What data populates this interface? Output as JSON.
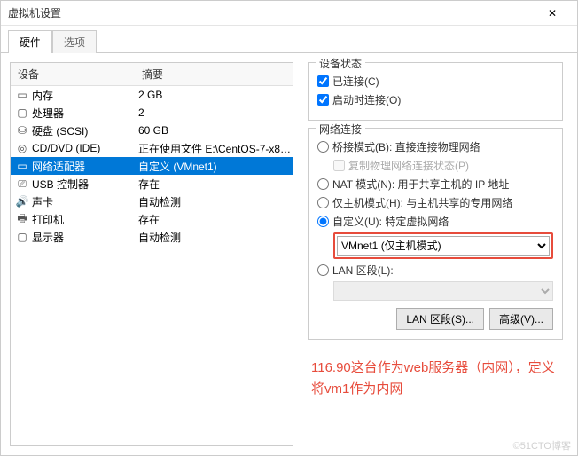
{
  "title": "虚拟机设置",
  "close": "✕",
  "tabs": {
    "hardware": "硬件",
    "options": "选项"
  },
  "listHeader": {
    "device": "设备",
    "summary": "摘要"
  },
  "devices": [
    {
      "icon": "▭",
      "name": "内存",
      "summary": "2 GB"
    },
    {
      "icon": "▢",
      "name": "处理器",
      "summary": "2"
    },
    {
      "icon": "⛁",
      "name": "硬盘 (SCSI)",
      "summary": "60 GB"
    },
    {
      "icon": "◎",
      "name": "CD/DVD (IDE)",
      "summary": "正在使用文件 E:\\CentOS-7-x86..."
    },
    {
      "icon": "▭",
      "name": "网络适配器",
      "summary": "自定义 (VMnet1)"
    },
    {
      "icon": "⎚",
      "name": "USB 控制器",
      "summary": "存在"
    },
    {
      "icon": "🔊",
      "name": "声卡",
      "summary": "自动检测"
    },
    {
      "icon": "🖶",
      "name": "打印机",
      "summary": "存在"
    },
    {
      "icon": "▢",
      "name": "显示器",
      "summary": "自动检测"
    }
  ],
  "deviceState": {
    "title": "设备状态",
    "connected": "已连接(C)",
    "connectAtStartup": "启动时连接(O)"
  },
  "netConn": {
    "title": "网络连接",
    "bridged": "桥接模式(B): 直接连接物理网络",
    "replicate": "复制物理网络连接状态(P)",
    "nat": "NAT 模式(N): 用于共享主机的 IP 地址",
    "hostOnly": "仅主机模式(H): 与主机共享的专用网络",
    "custom": "自定义(U): 特定虚拟网络",
    "customSelect": "VMnet1 (仅主机模式)",
    "lan": "LAN 区段(L):"
  },
  "buttons": {
    "lanSegments": "LAN 区段(S)...",
    "advanced": "高级(V)..."
  },
  "annotation": "116.90这台作为web服务器（内网），定义将vm1作为内网",
  "watermark": "©51CTO博客"
}
